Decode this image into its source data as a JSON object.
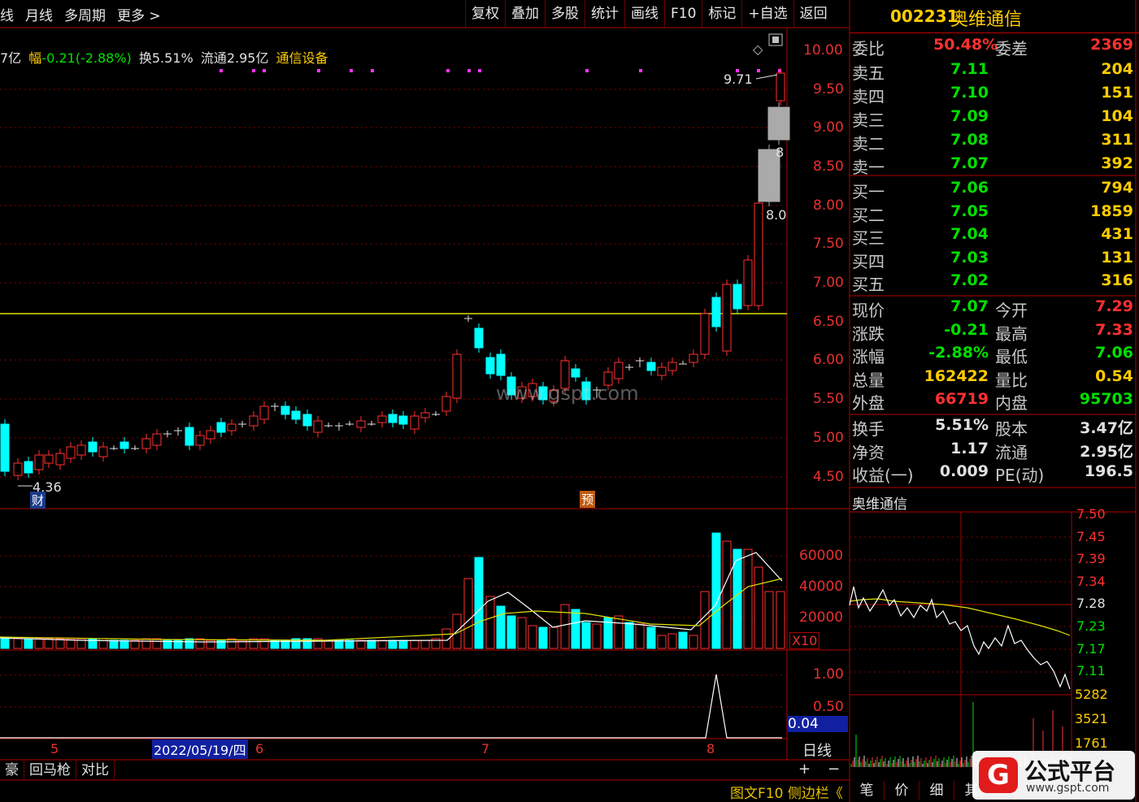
{
  "toolbar": {
    "left_items": [
      "线",
      "月线",
      "多周期",
      "更多 >"
    ],
    "right_buttons": [
      "复权",
      "叠加",
      "多股",
      "统计",
      "画线",
      "F10",
      "标记",
      "+自选",
      "返回"
    ]
  },
  "stock": {
    "code": "002231",
    "name": "奥维通信"
  },
  "info_line": {
    "prefix": "7亿",
    "range_label": "幅",
    "range_value": "-0.21(-2.88%)",
    "turnover": "换5.51%",
    "float": "流通2.95亿",
    "sector": "通信设备"
  },
  "price_axis": [
    "10.00",
    "9.50",
    "9.00",
    "8.50",
    "8.00",
    "7.50",
    "7.00",
    "6.50",
    "6.00",
    "5.50",
    "5.00",
    "4.50"
  ],
  "volume_axis": [
    "60000",
    "40000",
    "20000",
    "X10"
  ],
  "indicator_axis": [
    "1.00",
    "0.50",
    "0.04"
  ],
  "chart_annotations": {
    "high_label": "9.71",
    "low_label": "4.36",
    "mid_label_a": "8.0",
    "mid_label_b": "8",
    "finance_tag": "财",
    "forecast_tag": "预",
    "watermark": "www.gspt.com"
  },
  "date_axis": {
    "m5": "5",
    "selected": "2022/05/19/四",
    "m6": "6",
    "m7": "7",
    "m8": "8",
    "period": "日线"
  },
  "order_book": {
    "wei_bi_label": "委比",
    "wei_bi": "50.48%",
    "wei_cha_label": "委差",
    "wei_cha": "2369",
    "asks": [
      {
        "label": "卖五",
        "price": "7.11",
        "vol": "204"
      },
      {
        "label": "卖四",
        "price": "7.10",
        "vol": "151"
      },
      {
        "label": "卖三",
        "price": "7.09",
        "vol": "104"
      },
      {
        "label": "卖二",
        "price": "7.08",
        "vol": "311"
      },
      {
        "label": "卖一",
        "price": "7.07",
        "vol": "392"
      }
    ],
    "bids": [
      {
        "label": "买一",
        "price": "7.06",
        "vol": "794"
      },
      {
        "label": "买二",
        "price": "7.05",
        "vol": "1859"
      },
      {
        "label": "买三",
        "price": "7.04",
        "vol": "431"
      },
      {
        "label": "买四",
        "price": "7.03",
        "vol": "131"
      },
      {
        "label": "买五",
        "price": "7.02",
        "vol": "316"
      }
    ]
  },
  "quote": [
    {
      "l1": "现价",
      "v1": "7.07",
      "l2": "今开",
      "v2": "7.29"
    },
    {
      "l1": "涨跌",
      "v1": "-0.21",
      "l2": "最高",
      "v2": "7.33"
    },
    {
      "l1": "涨幅",
      "v1": "-2.88%",
      "l2": "最低",
      "v2": "7.06"
    },
    {
      "l1": "总量",
      "v1": "162422",
      "l2": "量比",
      "v2": "0.54"
    },
    {
      "l1": "外盘",
      "v1": "66719",
      "l2": "内盘",
      "v2": "95703"
    }
  ],
  "fundamentals": [
    {
      "l1": "换手",
      "v1": "5.51%",
      "l2": "股本",
      "v2": "3.47亿"
    },
    {
      "l1": "净资",
      "v1": "1.17",
      "l2": "流通",
      "v2": "2.95亿"
    },
    {
      "l1": "收益(一)",
      "v1": "0.009",
      "l2": "PE(动)",
      "v2": "196.5"
    }
  ],
  "intraday": {
    "title": "奥维通信",
    "price_axis": [
      "7.50",
      "7.45",
      "7.39",
      "7.34",
      "7.28",
      "7.23",
      "7.17",
      "7.11"
    ],
    "vol_axis": [
      "5282",
      "3521",
      "1761"
    ]
  },
  "bottom_tabs": [
    "豪",
    "回马枪",
    "对比"
  ],
  "zoom_controls": [
    "+",
    "−"
  ],
  "foot_links": "图文F10 侧边栏《",
  "right_tabs": [
    "笔",
    "价",
    "细",
    "其"
  ],
  "logo": {
    "mark": "G",
    "name": "公式平台",
    "url": "www.gspt.com"
  },
  "colors": {
    "up": "#ff3030",
    "down": "#00ffff",
    "grid": "#a00000",
    "accent": "#ffcc00",
    "neg": "#00e000"
  }
}
